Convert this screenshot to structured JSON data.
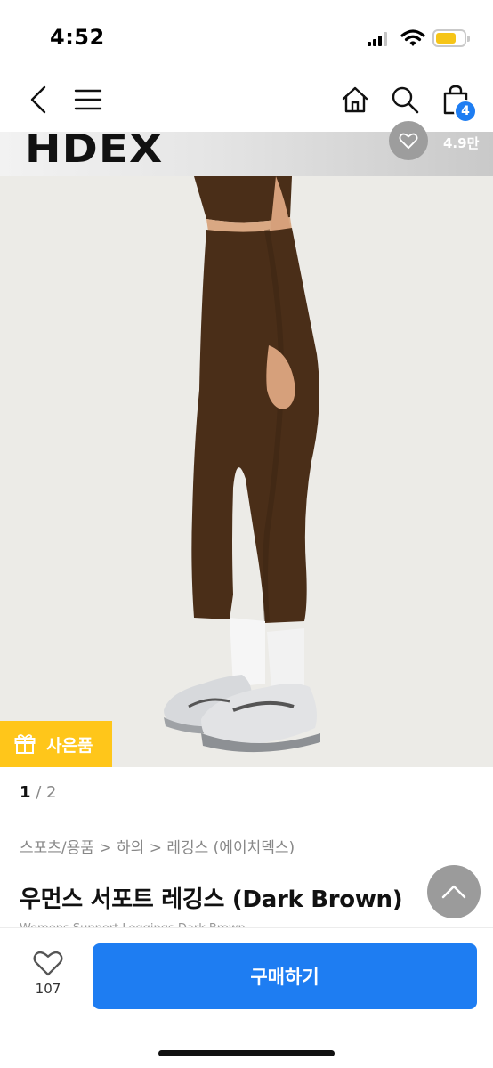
{
  "status_bar": {
    "time": "4:52"
  },
  "nav": {
    "cart_count": "4"
  },
  "brand": {
    "name": "HDEX",
    "likes": "4.9만"
  },
  "gift": {
    "label": "사은품"
  },
  "gallery": {
    "current": "1",
    "total": "/ 2"
  },
  "breadcrumb": {
    "items": [
      "스포츠/용품",
      ">",
      "하의",
      ">",
      "레깅스",
      "(에이치덱스)"
    ]
  },
  "product": {
    "title": "우먼스 서포트 레깅스 (Dark Brown)",
    "subtitle": "Womens Support Leggings Dark Brown"
  },
  "bottom": {
    "wish_count": "107",
    "buy_label": "구매하기"
  },
  "colors": {
    "accent": "#1e7df2",
    "gift": "#ffc61a",
    "leggings": "#4a2e18"
  }
}
